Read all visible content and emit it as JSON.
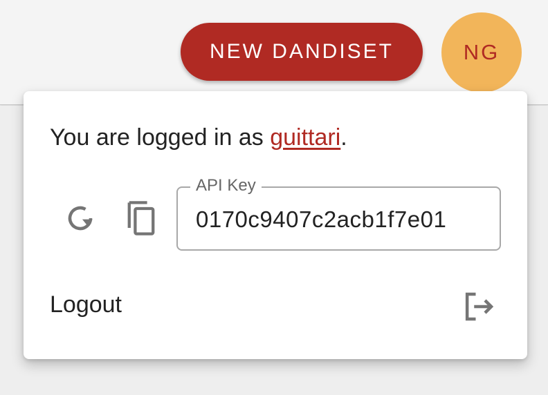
{
  "header": {
    "new_dandiset_label": "NEW DANDISET",
    "avatar_initials": "NG"
  },
  "user_menu": {
    "logged_in_prefix": "You are logged in as ",
    "username": "guittari",
    "logged_in_suffix": ".",
    "api_key": {
      "label": "API Key",
      "value": "0170c9407c2acb1f7e01"
    },
    "refresh_icon": "refresh-icon",
    "copy_icon": "copy-icon",
    "logout_label": "Logout",
    "logout_icon": "logout-icon"
  },
  "colors": {
    "brand_red": "#b02a23",
    "avatar_bg": "#f2b55a"
  }
}
